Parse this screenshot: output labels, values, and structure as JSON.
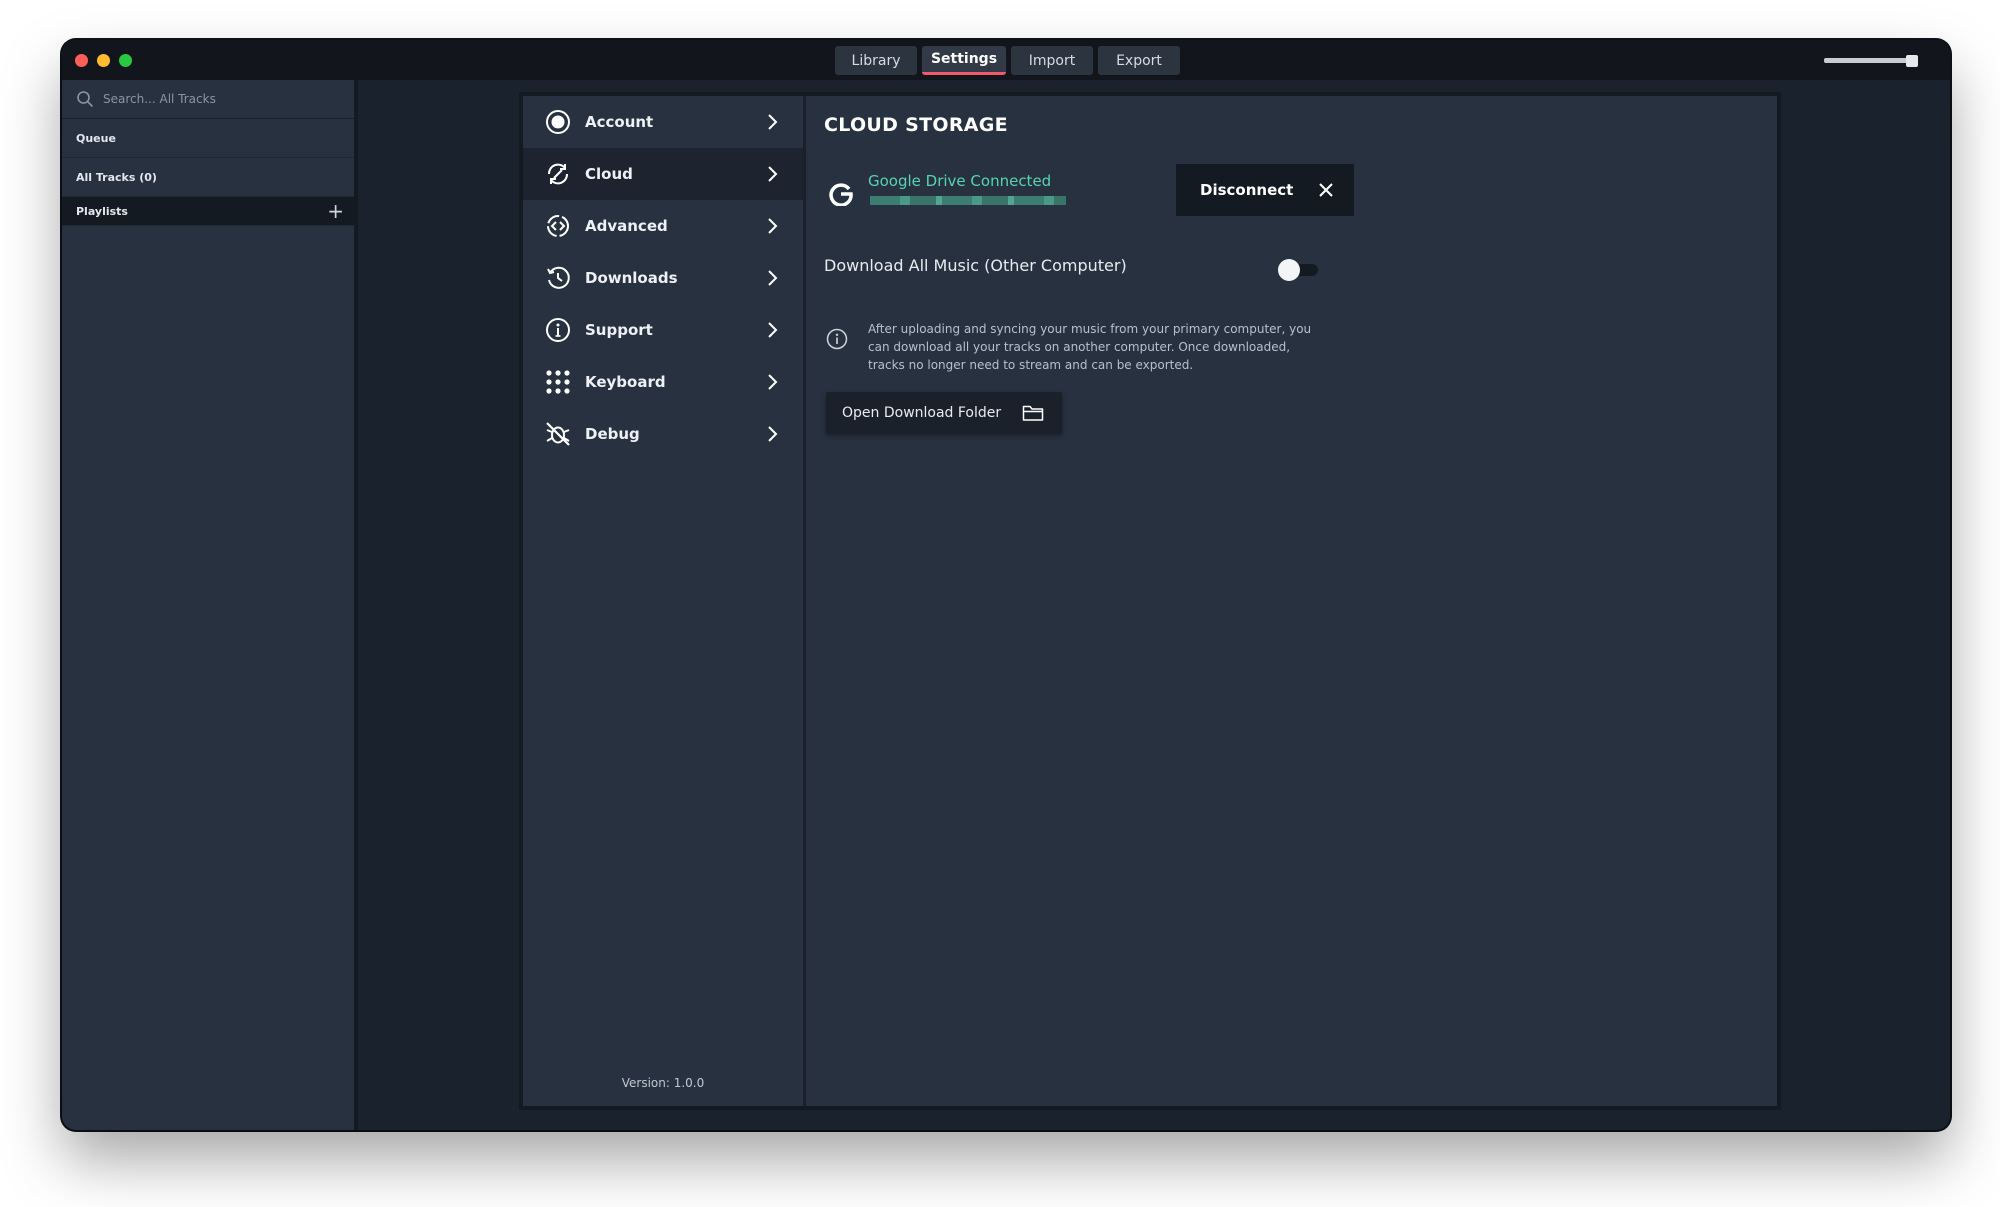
{
  "titlebar": {
    "tabs": [
      {
        "label": "Library"
      },
      {
        "label": "Settings"
      },
      {
        "label": "Import"
      },
      {
        "label": "Export"
      }
    ],
    "volume_level": 0.9
  },
  "sidebar": {
    "search_placeholder": "Search... All Tracks",
    "items": [
      {
        "label": "Queue"
      },
      {
        "label": "All Tracks (0)"
      },
      {
        "label": "Playlists"
      }
    ]
  },
  "settings_nav": {
    "items": [
      {
        "label": "Account",
        "icon": "account-icon"
      },
      {
        "label": "Cloud",
        "icon": "cloud-sync-icon"
      },
      {
        "label": "Advanced",
        "icon": "advanced-icon"
      },
      {
        "label": "Downloads",
        "icon": "downloads-icon"
      },
      {
        "label": "Support",
        "icon": "info-icon"
      },
      {
        "label": "Keyboard",
        "icon": "keyboard-icon"
      },
      {
        "label": "Debug",
        "icon": "debug-icon"
      }
    ],
    "active": "Cloud",
    "version": "Version: 1.0.0"
  },
  "cloud": {
    "title": "CLOUD STORAGE",
    "provider_status": "Google Drive Connected",
    "disconnect_label": "Disconnect",
    "download_all_label": "Download All Music (Other Computer)",
    "download_all_enabled": false,
    "info_text": "After uploading and syncing your music from your primary computer, you can download all your tracks on another computer. Once downloaded, tracks no longer need to stream and can be exported.",
    "open_folder_label": "Open Download Folder"
  },
  "colors": {
    "accent_active_tab": "#f05a6b",
    "connected_green": "#58d4b3",
    "panel_bg": "#27313f"
  }
}
